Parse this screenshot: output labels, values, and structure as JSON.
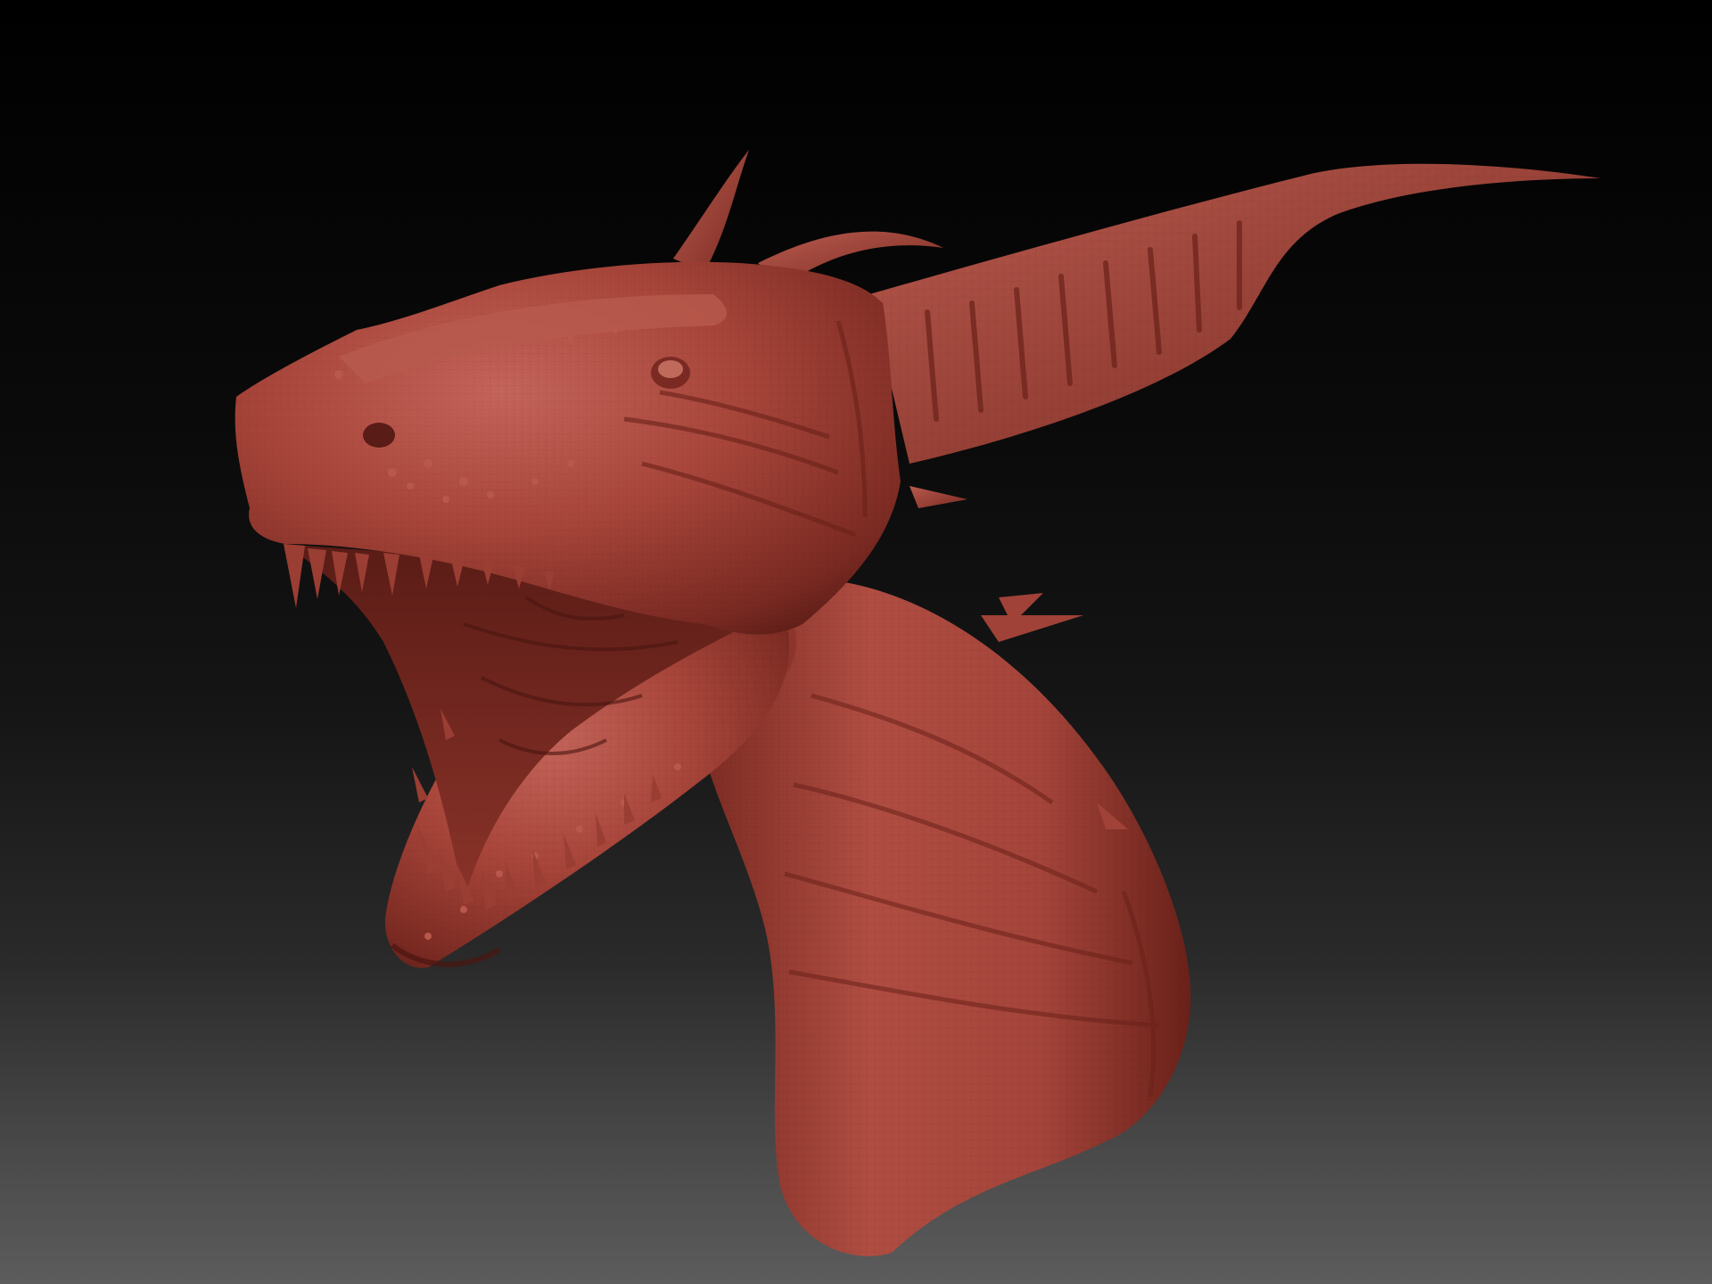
{
  "viewport": {
    "background_top": "#000000",
    "background_bottom": "#5c5c5c"
  },
  "model": {
    "subject": "dragon-head",
    "material_color": "#a8453a",
    "material_shadow": "#5a1c16",
    "material_highlight": "#c8685a"
  }
}
